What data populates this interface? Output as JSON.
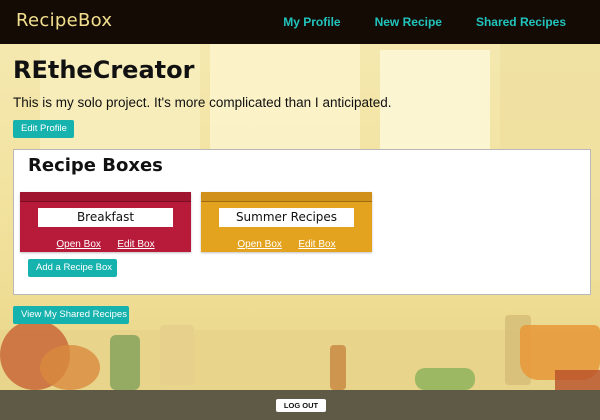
{
  "nav": {
    "brand": "RecipeBox",
    "links": [
      "My Profile",
      "New Recipe",
      "Shared Recipes"
    ]
  },
  "profile": {
    "username": "REtheCreator",
    "intro": "This is my solo project. It's more complicated than I anticipated.",
    "edit_button": "Edit Profile"
  },
  "recipe_boxes": {
    "title": "Recipe Boxes",
    "boxes": [
      {
        "name": "Breakfast",
        "open_label": "Open Box",
        "edit_label": "Edit Box",
        "color": "#b81a3a"
      },
      {
        "name": "Summer Recipes",
        "open_label": "Open Box",
        "edit_label": "Edit Box",
        "color": "#e3a31f"
      }
    ],
    "add_button": "Add a Recipe Box"
  },
  "shared_button": "View My Shared Recipes",
  "footer": {
    "logout": "LOG OUT"
  },
  "colors": {
    "nav_bg": "#140b05",
    "brand": "#f2e08e",
    "accent": "#16b2ad",
    "footer_bg": "#5e5a46"
  }
}
